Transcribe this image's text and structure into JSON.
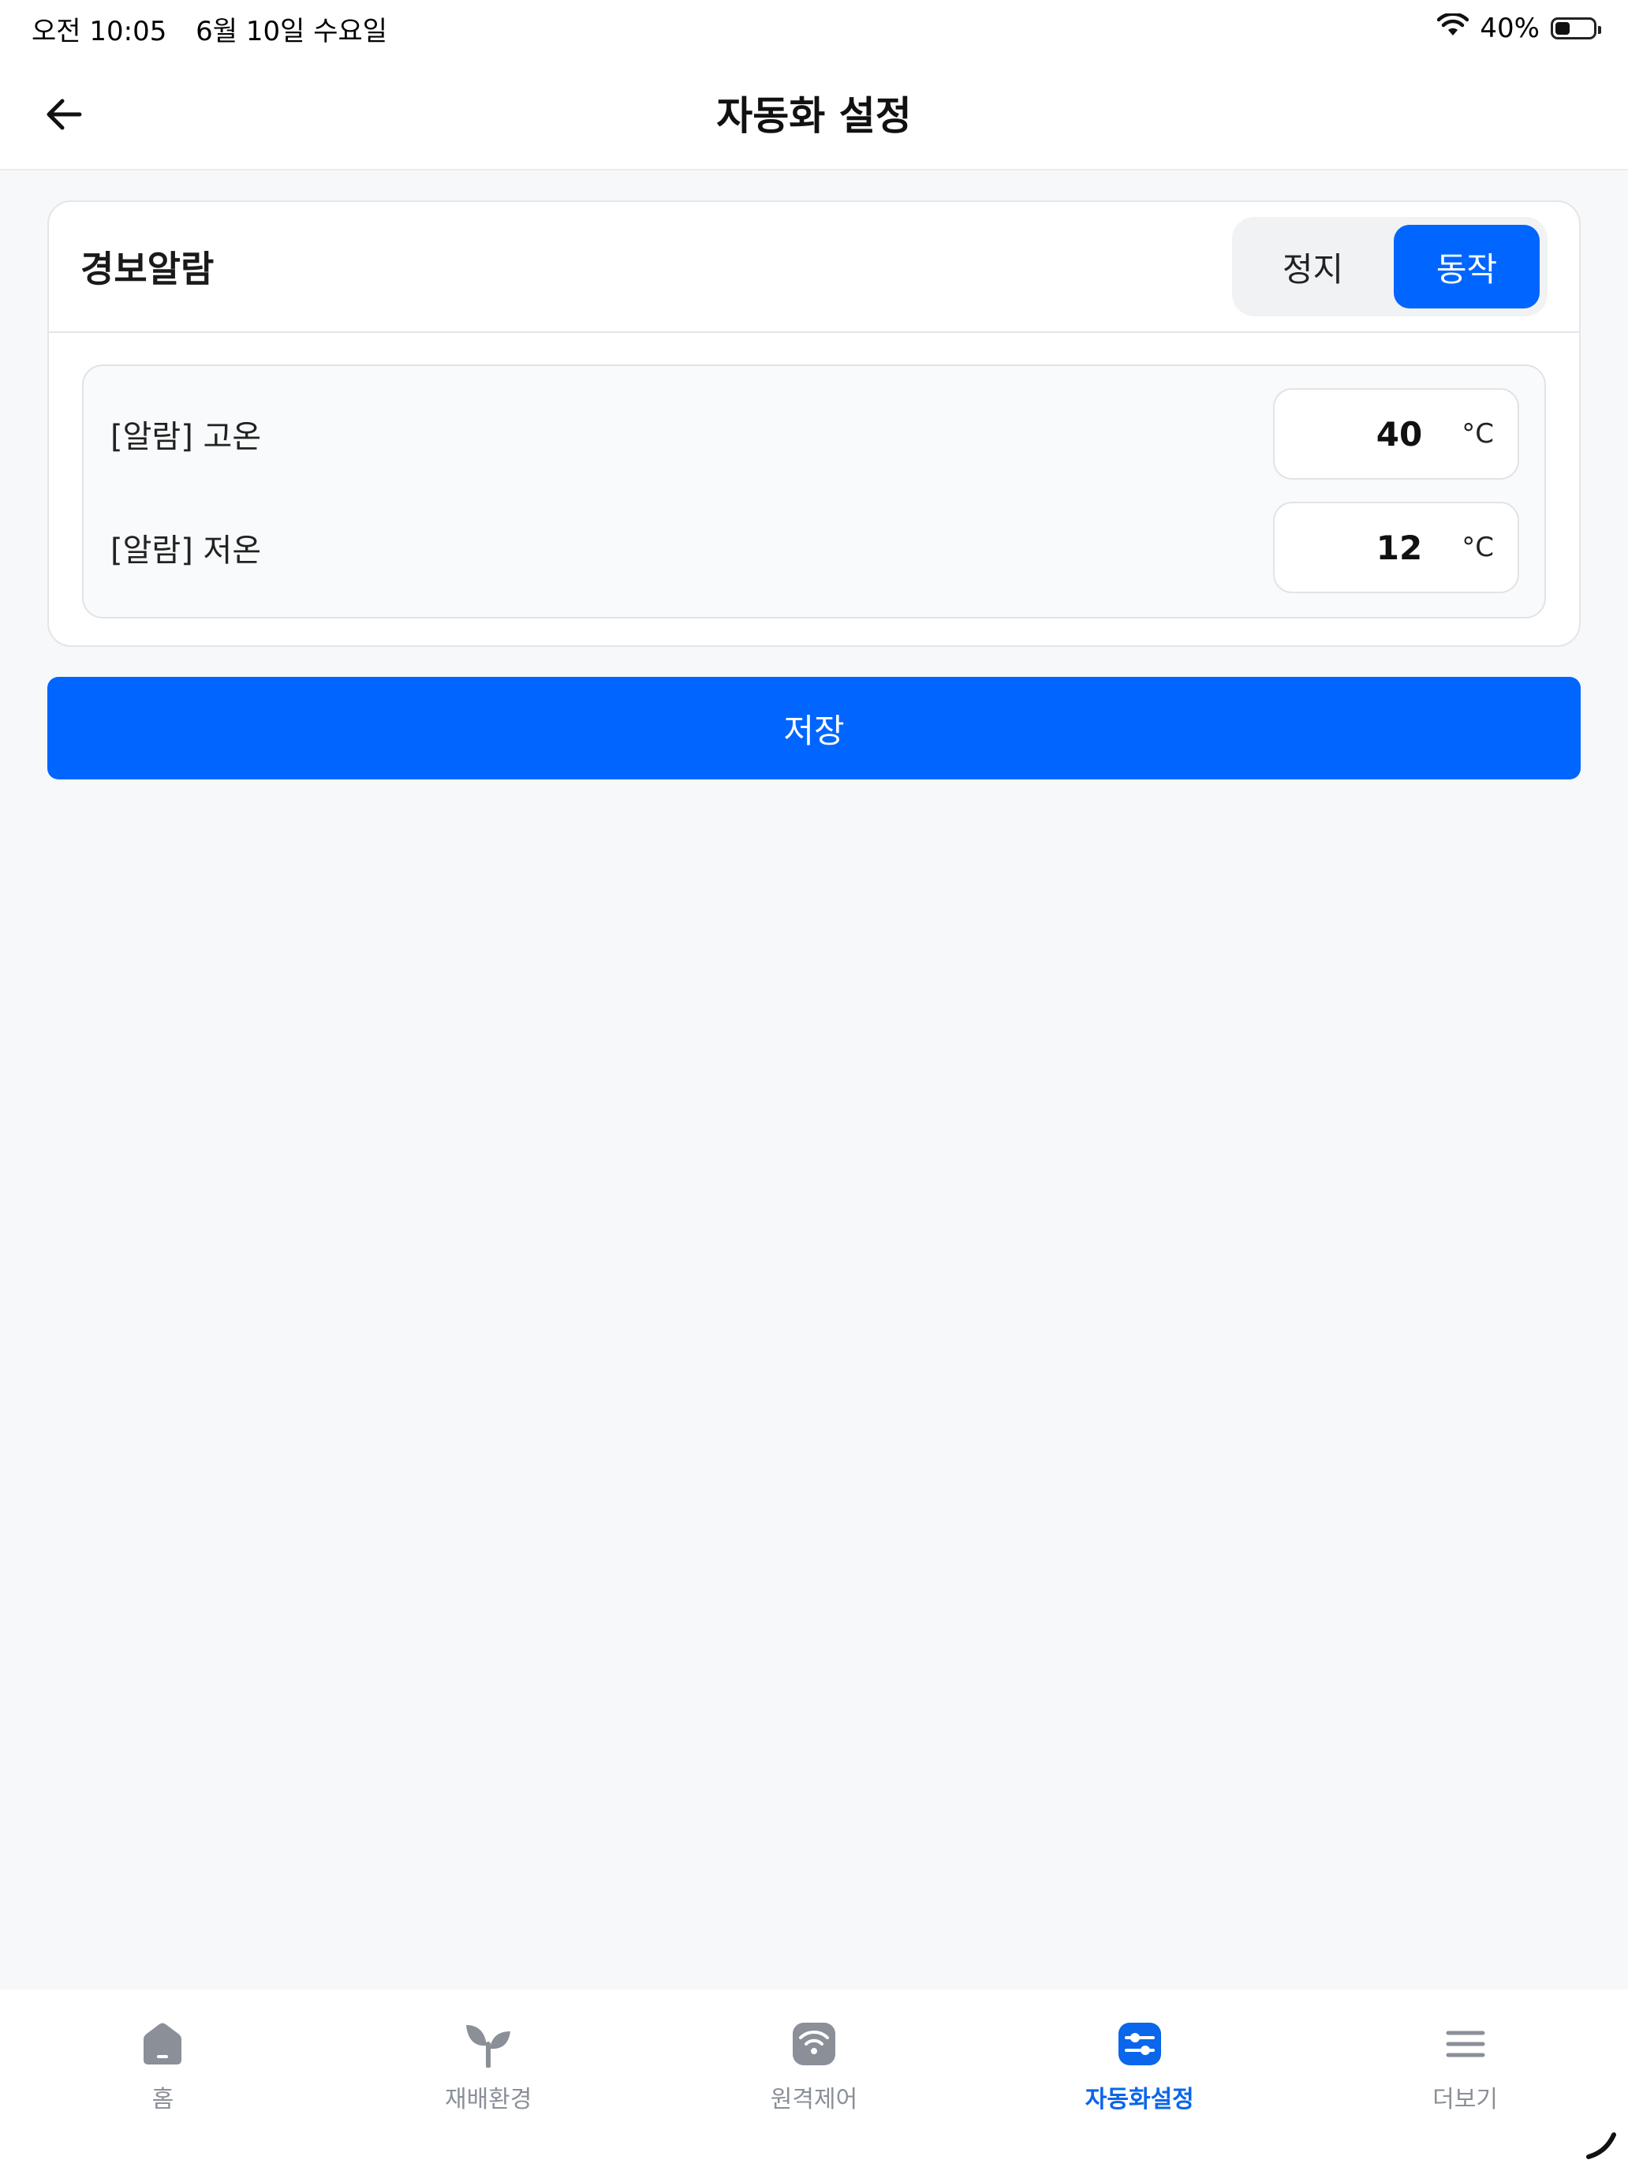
{
  "status_bar": {
    "time": "오전 10:05",
    "date": "6월 10일 수요일",
    "battery": "40%"
  },
  "header": {
    "title": "자동화 설정",
    "back_icon": "arrow-left-icon"
  },
  "alarm_card": {
    "title": "경보알람",
    "toggle": {
      "off_label": "정지",
      "on_label": "동작",
      "selected": "동작"
    },
    "rows": [
      {
        "label": "[알람] 고온",
        "value": "40",
        "unit": "°C"
      },
      {
        "label": "[알람] 저온",
        "value": "12",
        "unit": "°C"
      }
    ]
  },
  "save_label": "저장",
  "tabs": [
    {
      "label": "홈",
      "icon": "home-icon",
      "active": false
    },
    {
      "label": "재배환경",
      "icon": "sprout-icon",
      "active": false
    },
    {
      "label": "원격제어",
      "icon": "wifi-icon",
      "active": false
    },
    {
      "label": "자동화설정",
      "icon": "sliders-icon",
      "active": true
    },
    {
      "label": "더보기",
      "icon": "menu-icon",
      "active": false
    }
  ],
  "colors": {
    "accent": "#0066ff",
    "inactive_tab": "#8a8f98",
    "background": "#f7f8fa"
  }
}
